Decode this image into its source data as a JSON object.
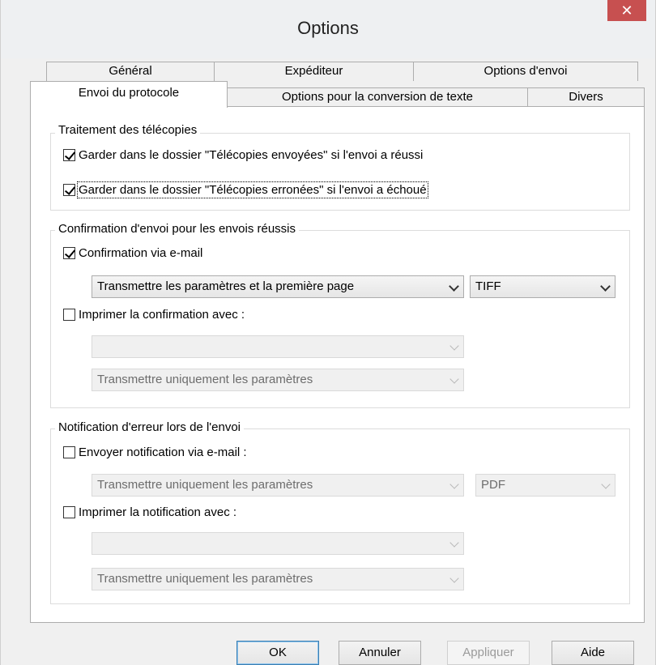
{
  "window": {
    "title": "Options",
    "close_symbol": "✕"
  },
  "tabs_row1": [
    {
      "label": "Général"
    },
    {
      "label": "Expéditeur"
    },
    {
      "label": "Options d'envoi"
    }
  ],
  "tabs_row2": [
    {
      "label": "Envoi du protocole",
      "active": true
    },
    {
      "label": "Options pour la conversion de texte"
    },
    {
      "label": "Divers"
    }
  ],
  "group_fax": {
    "title": "Traitement des télécopies",
    "keep_sent": {
      "label": "Garder dans le dossier \"Télécopies envoyées\" si l'envoi a réussi",
      "checked": true
    },
    "keep_failed": {
      "label": "Garder dans le dossier \"Télécopies erronées\" si l'envoi a échoué",
      "checked": true
    }
  },
  "group_confirm": {
    "title": "Confirmation d'envoi pour les envois réussis",
    "email": {
      "label": "Confirmation via e-mail",
      "checked": true
    },
    "email_content_value": "Transmettre les paramètres et la première page",
    "email_format_value": "TIFF",
    "print": {
      "label": "Imprimer la confirmation avec :",
      "checked": false
    },
    "printer_value": "",
    "print_content_value": "Transmettre uniquement les paramètres"
  },
  "group_error": {
    "title": "Notification d'erreur lors de l'envoi",
    "email": {
      "label": "Envoyer notification via e-mail :",
      "checked": false
    },
    "email_content_value": "Transmettre uniquement les paramètres",
    "email_format_value": "PDF",
    "print": {
      "label": "Imprimer la notification avec :",
      "checked": false
    },
    "printer_value": "",
    "print_content_value": "Transmettre uniquement les paramètres"
  },
  "buttons": {
    "ok": "OK",
    "cancel": "Annuler",
    "apply": "Appliquer",
    "help": "Aide"
  }
}
